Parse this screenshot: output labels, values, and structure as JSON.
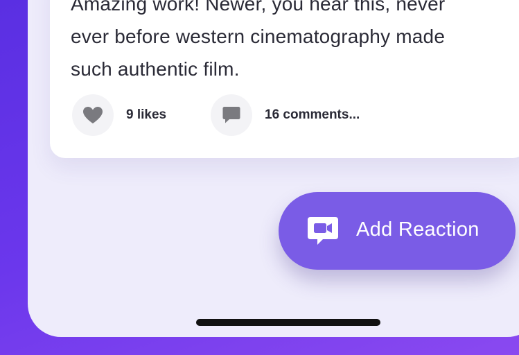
{
  "post": {
    "text_lines": [
      "Amazing work! Newer, you hear this, never",
      "ever before western cinematography made",
      "such authentic film."
    ],
    "likes_label": "9 likes",
    "comments_label": "16 comments...",
    "likes_icon": "heart-icon",
    "comments_icon": "comment-icon"
  },
  "add_reaction": {
    "label": "Add Reaction",
    "icon": "video-chat-icon"
  },
  "colors": {
    "accent": "#7a5ce6",
    "background_gradient_start": "#5b2ee0",
    "background_gradient_end": "#8f4cf2",
    "screen": "#eeecfb",
    "card": "#ffffff",
    "icon_gray": "#7a7a7f"
  }
}
